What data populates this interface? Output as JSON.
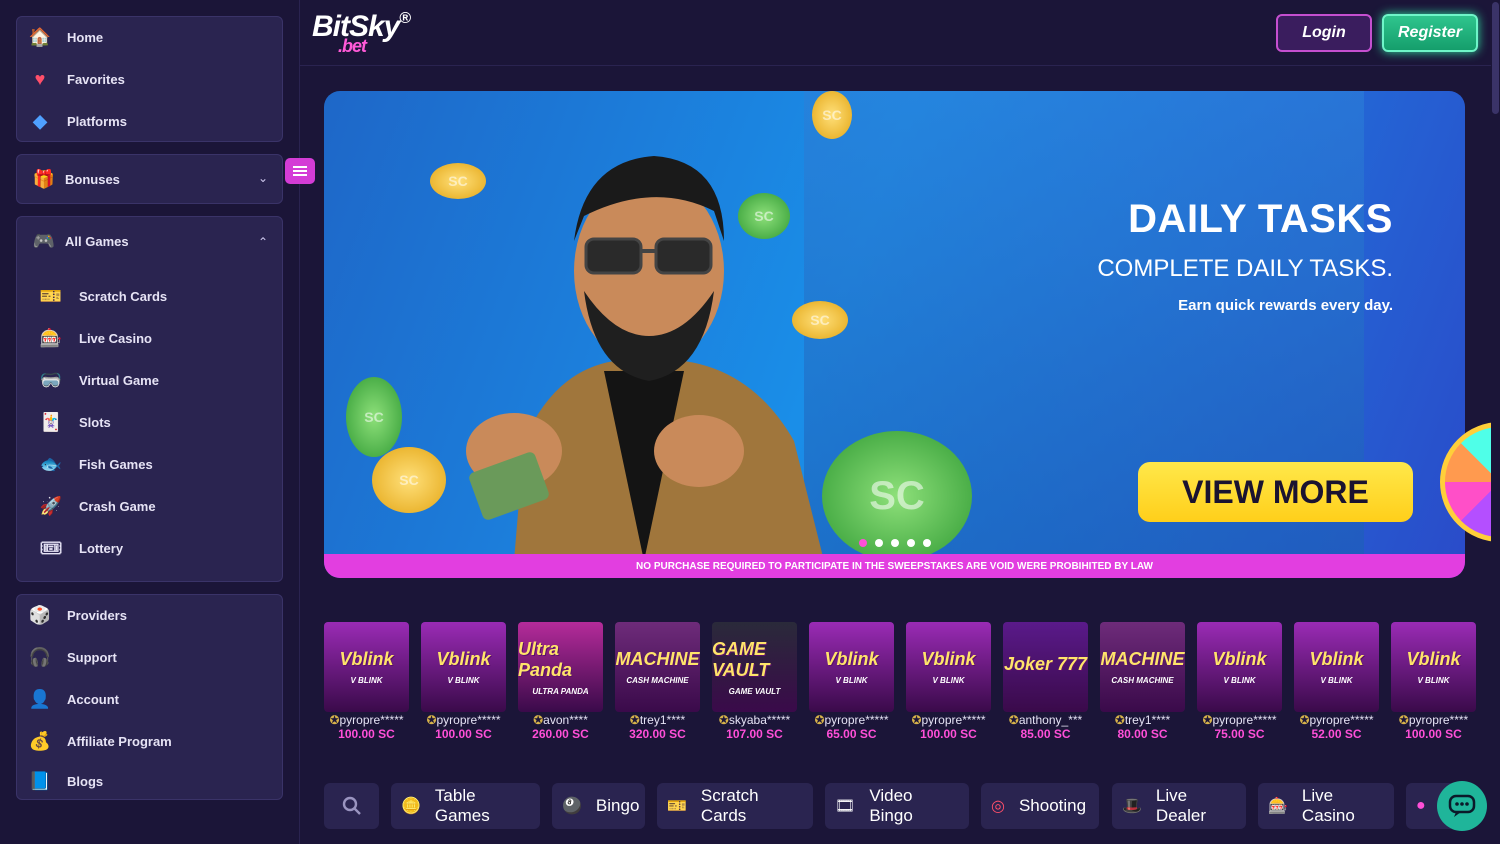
{
  "sidebar": {
    "top_items": [
      {
        "label": "Home",
        "icon": "home-icon"
      },
      {
        "label": "Favorites",
        "icon": "heart-icon"
      },
      {
        "label": "Platforms",
        "icon": "platforms-icon"
      }
    ],
    "bonuses": {
      "label": "Bonuses",
      "icon": "gift-icon"
    },
    "all_games": {
      "label": "All Games",
      "icon": "gamepad-icon",
      "items": [
        {
          "label": "Scratch Cards",
          "icon": "scratch-card-icon"
        },
        {
          "label": "Live Casino",
          "icon": "live-casino-icon"
        },
        {
          "label": "Virtual Game",
          "icon": "virtual-game-icon"
        },
        {
          "label": "Slots",
          "icon": "slots-icon"
        },
        {
          "label": "Fish Games",
          "icon": "fish-icon"
        },
        {
          "label": "Crash Game",
          "icon": "crash-game-icon"
        },
        {
          "label": "Lottery",
          "icon": "lottery-icon"
        }
      ]
    },
    "bottom_items": [
      {
        "label": "Providers",
        "icon": "providers-icon"
      },
      {
        "label": "Support",
        "icon": "headset-icon"
      },
      {
        "label": "Account",
        "icon": "account-icon"
      },
      {
        "label": "Affiliate Program",
        "icon": "affiliate-icon"
      },
      {
        "label": "Blogs",
        "icon": "blogs-icon"
      }
    ]
  },
  "header": {
    "logo_main": "BitSky",
    "logo_sub": ".bet",
    "logo_reg": "®",
    "login_label": "Login",
    "register_label": "Register"
  },
  "banner": {
    "title": "DAILY TASKS",
    "subtitle": "COMPLETE DAILY TASKS.",
    "tagline": "Earn quick rewards every day.",
    "cta": "VIEW MORE",
    "disclaimer": "NO PURCHASE REQUIRED TO PARTICIPATE IN THE SWEEPSTAKES ARE VOID WERE PROBIHITED BY LAW",
    "slides_count": 5,
    "active_slide": 1,
    "coin_label": "SC"
  },
  "wins": [
    {
      "game": "V BLINK",
      "title": "Vblink",
      "user": "pyropre*****",
      "amount": "100.00 SC",
      "color": "#9a2bb5"
    },
    {
      "game": "V BLINK",
      "title": "Vblink",
      "user": "pyropre*****",
      "amount": "100.00 SC",
      "color": "#9a2bb5"
    },
    {
      "game": "ULTRA PANDA",
      "title": "Ultra Panda",
      "user": "avon****",
      "amount": "260.00 SC",
      "color": "#b52b9a"
    },
    {
      "game": "CASH MACHINE",
      "title": "MACHINE",
      "user": "trey1****",
      "amount": "320.00 SC",
      "color": "#6e2b7a"
    },
    {
      "game": "GAME VAULT",
      "title": "GAME VAULT",
      "user": "skyaba*****",
      "amount": "107.00 SC",
      "color": "#2a2a3a"
    },
    {
      "game": "V BLINK",
      "title": "Vblink",
      "user": "pyropre*****",
      "amount": "65.00 SC",
      "color": "#9a2bb5"
    },
    {
      "game": "V BLINK",
      "title": "Vblink",
      "user": "pyropre*****",
      "amount": "100.00 SC",
      "color": "#9a2bb5"
    },
    {
      "game": "",
      "title": "Joker 777",
      "user": "anthony_***",
      "amount": "85.00 SC",
      "color": "#5a1a8a"
    },
    {
      "game": "CASH MACHINE",
      "title": "MACHINE",
      "user": "trey1****",
      "amount": "80.00 SC",
      "color": "#6e2b7a"
    },
    {
      "game": "V BLINK",
      "title": "Vblink",
      "user": "pyropre*****",
      "amount": "75.00 SC",
      "color": "#9a2bb5"
    },
    {
      "game": "V BLINK",
      "title": "Vblink",
      "user": "pyropre*****",
      "amount": "52.00 SC",
      "color": "#9a2bb5"
    },
    {
      "game": "V BLINK",
      "title": "Vblink",
      "user": "pyropre****",
      "amount": "100.00 SC",
      "color": "#9a2bb5"
    }
  ],
  "categories": [
    {
      "label": "Table Games",
      "icon": "table-games-icon"
    },
    {
      "label": "Bingo",
      "icon": "bingo-icon"
    },
    {
      "label": "Scratch Cards",
      "icon": "scratch-card-icon"
    },
    {
      "label": "Video Bingo",
      "icon": "video-bingo-icon"
    },
    {
      "label": "Shooting",
      "icon": "target-icon"
    },
    {
      "label": "Live Dealer",
      "icon": "live-dealer-icon"
    },
    {
      "label": "Live Casino",
      "icon": "live-casino-icon"
    }
  ],
  "colors": {
    "accent_pink": "#ff4fd8",
    "register_green": "#2fc58e",
    "cta_yellow": "#ffe84a",
    "panel": "#2a2450",
    "background": "#1b1538"
  }
}
